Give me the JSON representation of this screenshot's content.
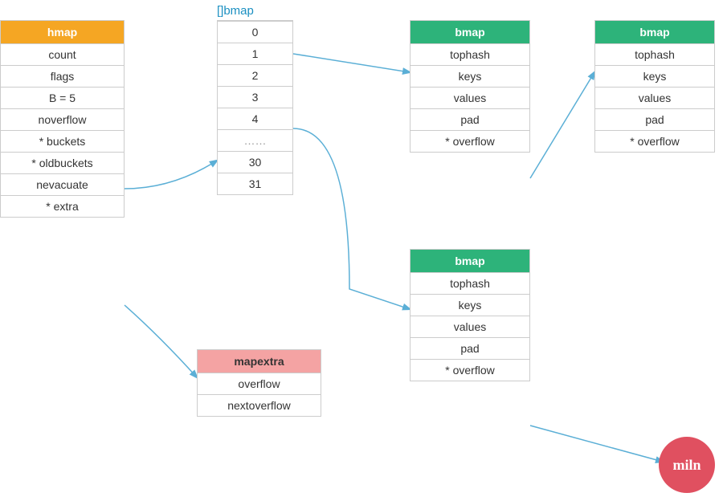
{
  "hmap": {
    "header": "hmap",
    "fields": [
      "count",
      "flags",
      "B = 5",
      "noverflow",
      "* buckets",
      "* oldbuckets",
      "nevacuate",
      "* extra"
    ]
  },
  "bmap_array": {
    "label": "[]bmap",
    "entries": [
      "0",
      "1",
      "2",
      "3",
      "4",
      "……",
      "30",
      "31"
    ]
  },
  "bmap1": {
    "header": "bmap",
    "fields": [
      "tophash",
      "keys",
      "values",
      "pad",
      "* overflow"
    ]
  },
  "bmap2": {
    "header": "bmap",
    "fields": [
      "tophash",
      "keys",
      "values",
      "pad",
      "* overflow"
    ]
  },
  "bmap3": {
    "header": "bmap",
    "fields": [
      "tophash",
      "keys",
      "values",
      "pad",
      "* overflow"
    ]
  },
  "mapextra": {
    "header": "mapextra",
    "fields": [
      "overflow",
      "nextoverflow"
    ]
  },
  "logo": {
    "text": "miln"
  }
}
